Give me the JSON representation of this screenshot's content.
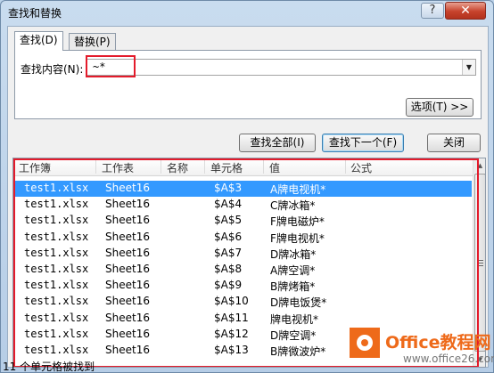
{
  "window": {
    "title": "查找和替换",
    "help": "?",
    "close": "✕"
  },
  "tabs": [
    {
      "label": "查找(D)"
    },
    {
      "label": "替换(P)"
    }
  ],
  "find": {
    "label": "查找内容(N):",
    "value": "~*"
  },
  "buttons": {
    "options": "选项(T) >>",
    "find_all": "查找全部(I)",
    "find_next": "查找下一个(F)",
    "close": "关闭"
  },
  "results": {
    "columns": [
      "工作簿",
      "工作表",
      "名称",
      "单元格",
      "值",
      "公式"
    ],
    "rows": [
      {
        "workbook": "test1.xlsx",
        "sheet": "Sheet16",
        "cell": "$A$3",
        "value": "A牌电视机*"
      },
      {
        "workbook": "test1.xlsx",
        "sheet": "Sheet16",
        "cell": "$A$4",
        "value": "C牌冰箱*"
      },
      {
        "workbook": "test1.xlsx",
        "sheet": "Sheet16",
        "cell": "$A$5",
        "value": "F牌电磁炉*"
      },
      {
        "workbook": "test1.xlsx",
        "sheet": "Sheet16",
        "cell": "$A$6",
        "value": "F牌电视机*"
      },
      {
        "workbook": "test1.xlsx",
        "sheet": "Sheet16",
        "cell": "$A$7",
        "value": "D牌冰箱*"
      },
      {
        "workbook": "test1.xlsx",
        "sheet": "Sheet16",
        "cell": "$A$8",
        "value": "A牌空调*"
      },
      {
        "workbook": "test1.xlsx",
        "sheet": "Sheet16",
        "cell": "$A$9",
        "value": "B牌烤箱*"
      },
      {
        "workbook": "test1.xlsx",
        "sheet": "Sheet16",
        "cell": "$A$10",
        "value": "D牌电饭煲*"
      },
      {
        "workbook": "test1.xlsx",
        "sheet": "Sheet16",
        "cell": "$A$11",
        "value": "牌电视机*"
      },
      {
        "workbook": "test1.xlsx",
        "sheet": "Sheet16",
        "cell": "$A$12",
        "value": "D牌空调*"
      },
      {
        "workbook": "test1.xlsx",
        "sheet": "Sheet16",
        "cell": "$A$13",
        "value": "B牌微波炉*"
      }
    ]
  },
  "status": "11 个单元格被找到",
  "watermark": {
    "title": "Office教程网",
    "url": "www.office26.com"
  },
  "colors": {
    "highlight": "#e41b2b",
    "selection": "#3399ff",
    "watermark": "#ee6a1a"
  }
}
